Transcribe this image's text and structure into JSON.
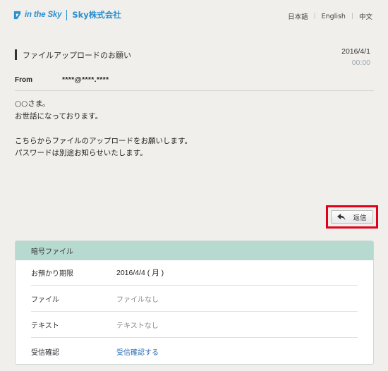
{
  "header": {
    "brand": "in the Sky",
    "company": "Sky株式会社",
    "languages": [
      "日本語",
      "English",
      "中文"
    ]
  },
  "message": {
    "subject": "ファイルアップロードのお願い",
    "date": "2016/4/1",
    "time": "00:00",
    "from_label": "From",
    "from_value": "****@****.****",
    "body_lines": [
      "○○さま。",
      "お世話になっております。",
      "",
      "こちらからファイルのアップロードをお願いします。",
      "パスワードは別途お知らせいたします。"
    ]
  },
  "actions": {
    "reply_label": "返信",
    "reply_icon": "reply-arrow-icon"
  },
  "panel": {
    "title": "暗号ファイル",
    "rows": [
      {
        "label": "お預かり期限",
        "value": "2016/4/4 ( 月 )"
      },
      {
        "label": "ファイル",
        "value": "ファイルなし"
      },
      {
        "label": "テキスト",
        "value": "テキストなし"
      },
      {
        "label": "受信確認",
        "value": "受信確認する"
      }
    ]
  },
  "colors": {
    "brand_blue": "#2b8fd0",
    "highlight_red": "#e3001b",
    "panel_header": "#b6d9d0",
    "link": "#2b6fb8"
  }
}
